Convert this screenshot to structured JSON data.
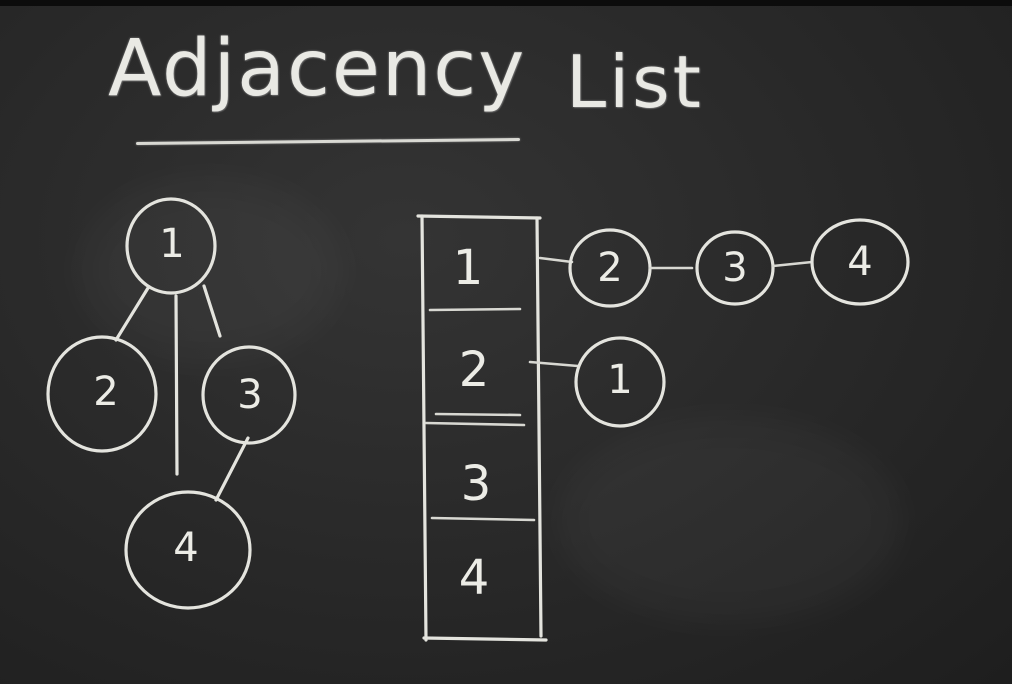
{
  "title": {
    "word1": "Adjacency",
    "word2": "List"
  },
  "graph": {
    "nodes": [
      "1",
      "2",
      "3",
      "4"
    ],
    "edges": [
      [
        "1",
        "2"
      ],
      [
        "1",
        "3"
      ],
      [
        "1",
        "4"
      ],
      [
        "3",
        "4"
      ]
    ]
  },
  "adjacency_list": {
    "slots": [
      "1",
      "2",
      "3",
      "4"
    ],
    "lists": {
      "1": [
        "2",
        "3",
        "4"
      ],
      "2": [
        "1"
      ],
      "3": [],
      "4": []
    }
  }
}
